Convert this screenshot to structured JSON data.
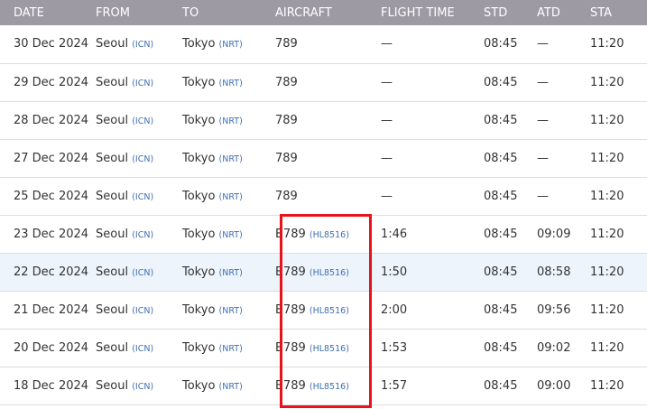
{
  "table": {
    "headers": [
      "DATE",
      "FROM",
      "TO",
      "AIRCRAFT",
      "FLIGHT TIME",
      "STD",
      "ATD",
      "STA"
    ],
    "rows": [
      {
        "date": "30 Dec 2024",
        "from_city": "Seoul",
        "from_code": "(ICN)",
        "to_city": "Tokyo",
        "to_code": "(NRT)",
        "aircraft": "789",
        "aircraft_reg": "",
        "flight_time": "—",
        "std": "08:45",
        "atd": "—",
        "sta": "11:20"
      },
      {
        "date": "29 Dec 2024",
        "from_city": "Seoul",
        "from_code": "(ICN)",
        "to_city": "Tokyo",
        "to_code": "(NRT)",
        "aircraft": "789",
        "aircraft_reg": "",
        "flight_time": "—",
        "std": "08:45",
        "atd": "—",
        "sta": "11:20"
      },
      {
        "date": "28 Dec 2024",
        "from_city": "Seoul",
        "from_code": "(ICN)",
        "to_city": "Tokyo",
        "to_code": "(NRT)",
        "aircraft": "789",
        "aircraft_reg": "",
        "flight_time": "—",
        "std": "08:45",
        "atd": "—",
        "sta": "11:20"
      },
      {
        "date": "27 Dec 2024",
        "from_city": "Seoul",
        "from_code": "(ICN)",
        "to_city": "Tokyo",
        "to_code": "(NRT)",
        "aircraft": "789",
        "aircraft_reg": "",
        "flight_time": "—",
        "std": "08:45",
        "atd": "—",
        "sta": "11:20"
      },
      {
        "date": "25 Dec 2024",
        "from_city": "Seoul",
        "from_code": "(ICN)",
        "to_city": "Tokyo",
        "to_code": "(NRT)",
        "aircraft": "789",
        "aircraft_reg": "",
        "flight_time": "—",
        "std": "08:45",
        "atd": "—",
        "sta": "11:20"
      },
      {
        "date": "23 Dec 2024",
        "from_city": "Seoul",
        "from_code": "(ICN)",
        "to_city": "Tokyo",
        "to_code": "(NRT)",
        "aircraft": "B789",
        "aircraft_reg": "(HL8516)",
        "flight_time": "1:46",
        "std": "08:45",
        "atd": "09:09",
        "sta": "11:20"
      },
      {
        "date": "22 Dec 2024",
        "from_city": "Seoul",
        "from_code": "(ICN)",
        "to_city": "Tokyo",
        "to_code": "(NRT)",
        "aircraft": "B789",
        "aircraft_reg": "(HL8516)",
        "flight_time": "1:50",
        "std": "08:45",
        "atd": "08:58",
        "sta": "11:20"
      },
      {
        "date": "21 Dec 2024",
        "from_city": "Seoul",
        "from_code": "(ICN)",
        "to_city": "Tokyo",
        "to_code": "(NRT)",
        "aircraft": "B789",
        "aircraft_reg": "(HL8516)",
        "flight_time": "2:00",
        "std": "08:45",
        "atd": "09:56",
        "sta": "11:20"
      },
      {
        "date": "20 Dec 2024",
        "from_city": "Seoul",
        "from_code": "(ICN)",
        "to_city": "Tokyo",
        "to_code": "(NRT)",
        "aircraft": "B789",
        "aircraft_reg": "(HL8516)",
        "flight_time": "1:53",
        "std": "08:45",
        "atd": "09:02",
        "sta": "11:20"
      },
      {
        "date": "18 Dec 2024",
        "from_city": "Seoul",
        "from_code": "(ICN)",
        "to_city": "Tokyo",
        "to_code": "(NRT)",
        "aircraft": "B789",
        "aircraft_reg": "(HL8516)",
        "flight_time": "1:57",
        "std": "08:45",
        "atd": "09:00",
        "sta": "11:20"
      }
    ]
  },
  "colors": {
    "header_bg": "#9e9aa3",
    "highlight_row_bg": "#eef4fb",
    "code_text": "#3f6fae",
    "annotation_box": "#e8121b"
  }
}
